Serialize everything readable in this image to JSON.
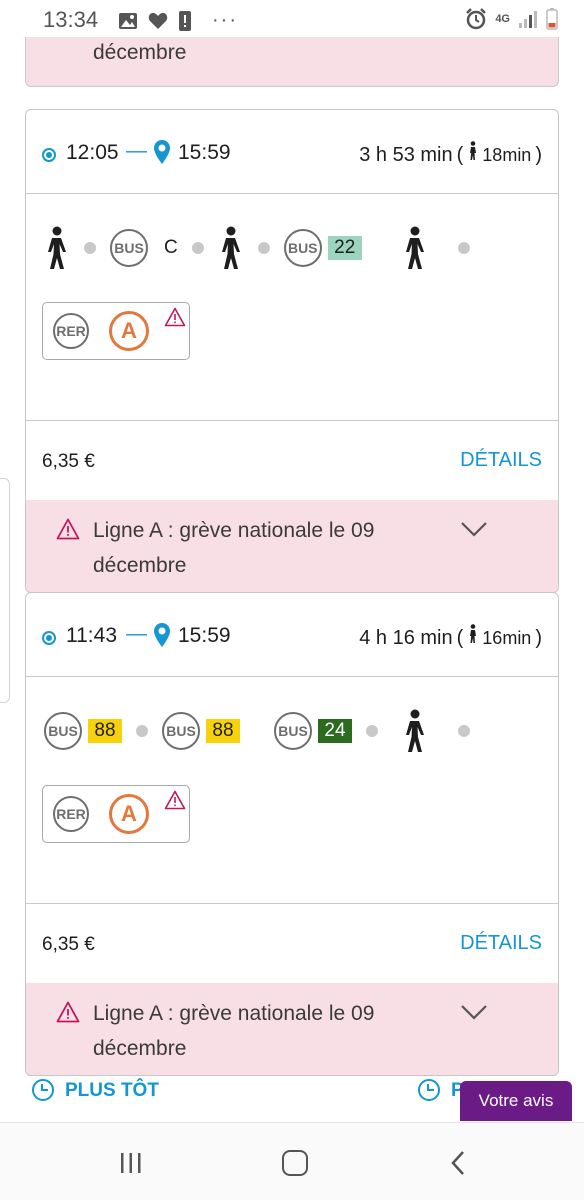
{
  "status_bar": {
    "time": "13:34",
    "network": "4G",
    "icons_left": [
      "image-icon",
      "heart-icon",
      "alert-icon"
    ],
    "icons_right": [
      "alarm-icon",
      "signal-icon",
      "battery-icon"
    ]
  },
  "top_alert": {
    "text": "décembre"
  },
  "routes": [
    {
      "depart": "12:05",
      "arrive": "15:59",
      "duration": "3 h 53 min",
      "walk_time": "18min",
      "legs": [
        {
          "mode": "walk"
        },
        {
          "mode": "bus",
          "line": "C",
          "badge": false
        },
        {
          "mode": "walk"
        },
        {
          "mode": "bus",
          "line": "22",
          "badge_color": "#9dd4bf",
          "badge_text_color": "#1e1e1e"
        },
        {
          "mode": "walk"
        }
      ],
      "disruption_icons": {
        "rer": "RER",
        "line": "A"
      },
      "price": "6,35 €",
      "details_label": "DÉTAILS",
      "alert": "Ligne A : grève nationale le 09 décembre"
    },
    {
      "depart": "11:43",
      "arrive": "15:59",
      "duration": "4 h 16 min",
      "walk_time": "16min",
      "legs": [
        {
          "mode": "bus",
          "line": "88",
          "badge_color": "#f7d20b",
          "badge_text_color": "#1e1e1e"
        },
        {
          "mode": "bus",
          "line": "88",
          "badge_color": "#f7d20b",
          "badge_text_color": "#1e1e1e"
        },
        {
          "mode": "bus",
          "line": "24",
          "badge_color": "#2d6c1f",
          "badge_text_color": "#ffffff"
        },
        {
          "mode": "walk"
        }
      ],
      "disruption_icons": {
        "rer": "RER",
        "line": "A"
      },
      "price": "6,35 €",
      "details_label": "DÉTAILS",
      "alert": "Ligne A : grève nationale le 09 décembre"
    }
  ],
  "links": {
    "earlier": "PLUS TÔT",
    "later_partial": "P"
  },
  "feedback_label": "Votre avis",
  "bus_label": "BUS",
  "colors": {
    "accent": "#1496d2",
    "alert_bg": "#f8dfe5",
    "warning": "#c2185b",
    "line_a": "#e4773b",
    "feedback": "#6a1b86"
  }
}
